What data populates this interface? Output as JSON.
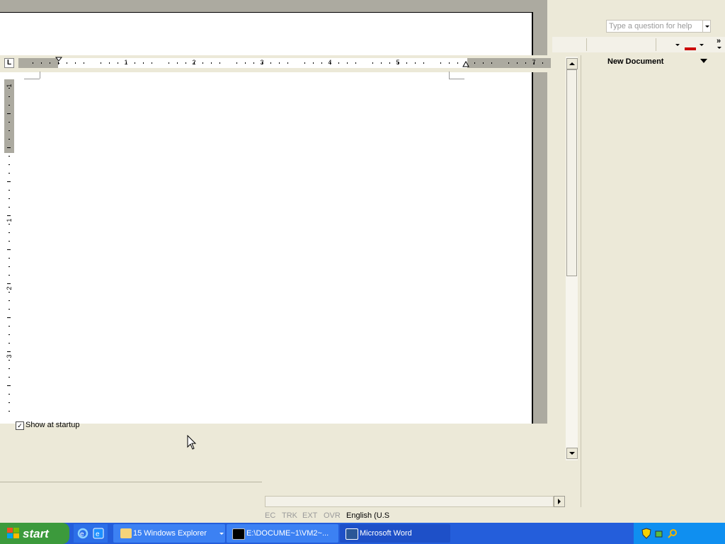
{
  "help_box": {
    "placeholder": "Type a question for help"
  },
  "toolbar": {
    "overflow_label": "»",
    "font_color": "#cc0000"
  },
  "ruler": {
    "tab_selector": "L",
    "numbers": [
      "1",
      "2",
      "3",
      "4",
      "5",
      "7"
    ],
    "vertical_numbers": [
      "1",
      "1",
      "2",
      "3"
    ]
  },
  "task_pane": {
    "title": "New Document"
  },
  "startup": {
    "label": "Show at startup",
    "checked": true,
    "check_mark": "✓"
  },
  "status_bar": {
    "rec": "EC",
    "trk": "TRK",
    "ext": "EXT",
    "ovr": "OVR",
    "language": "English (U.S"
  },
  "taskbar": {
    "start_label": "start",
    "buttons": [
      {
        "label": "15 Windows Explorer"
      },
      {
        "label": "E:\\DOCUME~1\\VM2~..."
      },
      {
        "label": "Microsoft Word"
      }
    ]
  }
}
